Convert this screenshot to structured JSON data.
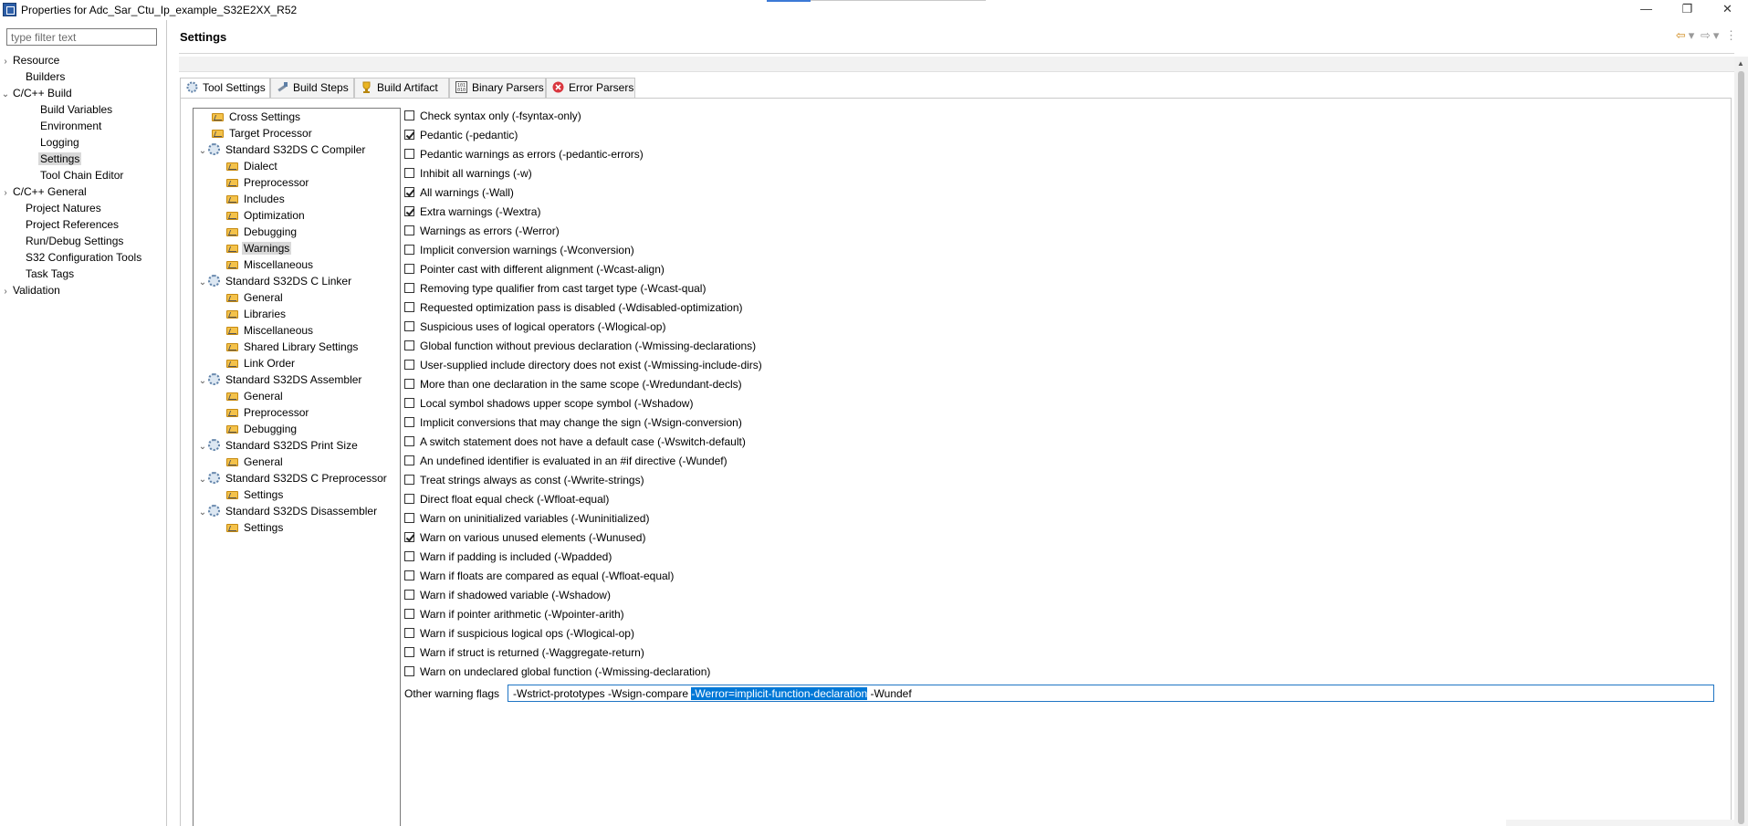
{
  "window": {
    "title": "Properties for Adc_Sar_Ctu_Ip_example_S32E2XX_R52",
    "minimize": "—",
    "restore": "❐",
    "close": "✕"
  },
  "filter": {
    "placeholder": "type filter text"
  },
  "left_tree": [
    {
      "label": "Resource",
      "chevron": "›"
    },
    {
      "label": "Builders",
      "chevron": ""
    },
    {
      "label": "C/C++ Build",
      "chevron": "⌄"
    },
    {
      "label": "Build Variables",
      "chevron": ""
    },
    {
      "label": "Environment",
      "chevron": ""
    },
    {
      "label": "Logging",
      "chevron": ""
    },
    {
      "label": "Settings",
      "chevron": "",
      "selected": true
    },
    {
      "label": "Tool Chain Editor",
      "chevron": ""
    },
    {
      "label": "C/C++ General",
      "chevron": "›"
    },
    {
      "label": "Project Natures",
      "chevron": ""
    },
    {
      "label": "Project References",
      "chevron": ""
    },
    {
      "label": "Run/Debug Settings",
      "chevron": ""
    },
    {
      "label": "S32 Configuration Tools",
      "chevron": ""
    },
    {
      "label": "Task Tags",
      "chevron": ""
    },
    {
      "label": "Validation",
      "chevron": "›"
    }
  ],
  "header": {
    "title": "Settings",
    "back_icon": "⇦",
    "dropdown": "▾",
    "forward_icon": "⇨",
    "menu_icon": "⋮"
  },
  "tabs": [
    {
      "label": "Tool Settings",
      "icon": "tool-settings-icon"
    },
    {
      "label": "Build Steps",
      "icon": "build-steps-icon"
    },
    {
      "label": "Build Artifact",
      "icon": "build-artifact-icon"
    },
    {
      "label": "Binary Parsers",
      "icon": "binary-parsers-icon"
    },
    {
      "label": "Error Parsers",
      "icon": "error-parsers-icon"
    }
  ],
  "tool_tree": [
    {
      "label": "Cross Settings",
      "chevron": ""
    },
    {
      "label": "Target Processor",
      "chevron": ""
    },
    {
      "label": "Standard S32DS C Compiler",
      "chevron": "⌄"
    },
    {
      "label": "Dialect",
      "chevron": ""
    },
    {
      "label": "Preprocessor",
      "chevron": ""
    },
    {
      "label": "Includes",
      "chevron": ""
    },
    {
      "label": "Optimization",
      "chevron": ""
    },
    {
      "label": "Debugging",
      "chevron": ""
    },
    {
      "label": "Warnings",
      "chevron": "",
      "selected": true
    },
    {
      "label": "Miscellaneous",
      "chevron": ""
    },
    {
      "label": "Standard S32DS C Linker",
      "chevron": "⌄"
    },
    {
      "label": "General",
      "chevron": ""
    },
    {
      "label": "Libraries",
      "chevron": ""
    },
    {
      "label": "Miscellaneous",
      "chevron": ""
    },
    {
      "label": "Shared Library Settings",
      "chevron": ""
    },
    {
      "label": "Link Order",
      "chevron": ""
    },
    {
      "label": "Standard S32DS Assembler",
      "chevron": "⌄"
    },
    {
      "label": "General",
      "chevron": ""
    },
    {
      "label": "Preprocessor",
      "chevron": ""
    },
    {
      "label": "Debugging",
      "chevron": ""
    },
    {
      "label": "Standard S32DS Print Size",
      "chevron": "⌄"
    },
    {
      "label": "General",
      "chevron": ""
    },
    {
      "label": "Standard S32DS C Preprocessor",
      "chevron": "⌄"
    },
    {
      "label": "Settings",
      "chevron": ""
    },
    {
      "label": "Standard S32DS Disassembler",
      "chevron": "⌄"
    },
    {
      "label": "Settings",
      "chevron": ""
    }
  ],
  "warnings": [
    {
      "label": "Check syntax only (-fsyntax-only)",
      "checked": false
    },
    {
      "label": "Pedantic (-pedantic)",
      "checked": true
    },
    {
      "label": "Pedantic warnings as errors (-pedantic-errors)",
      "checked": false
    },
    {
      "label": "Inhibit all warnings (-w)",
      "checked": false
    },
    {
      "label": "All warnings (-Wall)",
      "checked": true
    },
    {
      "label": "Extra warnings (-Wextra)",
      "checked": true
    },
    {
      "label": "Warnings as errors (-Werror)",
      "checked": false
    },
    {
      "label": "Implicit conversion warnings (-Wconversion)",
      "checked": false
    },
    {
      "label": "Pointer cast with different alignment (-Wcast-align)",
      "checked": false
    },
    {
      "label": "Removing type qualifier from cast target type (-Wcast-qual)",
      "checked": false
    },
    {
      "label": "Requested optimization pass is disabled (-Wdisabled-optimization)",
      "checked": false
    },
    {
      "label": "Suspicious uses of logical operators (-Wlogical-op)",
      "checked": false
    },
    {
      "label": "Global function without previous declaration (-Wmissing-declarations)",
      "checked": false
    },
    {
      "label": "User-supplied include directory does not exist (-Wmissing-include-dirs)",
      "checked": false
    },
    {
      "label": "More than one declaration in the same scope (-Wredundant-decls)",
      "checked": false
    },
    {
      "label": "Local symbol shadows upper scope symbol (-Wshadow)",
      "checked": false
    },
    {
      "label": "Implicit conversions that may change the sign (-Wsign-conversion)",
      "checked": false
    },
    {
      "label": "A switch statement does not have a default case (-Wswitch-default)",
      "checked": false
    },
    {
      "label": "An undefined identifier is evaluated in an #if directive (-Wundef)",
      "checked": false
    },
    {
      "label": "Treat strings always as const (-Wwrite-strings)",
      "checked": false
    },
    {
      "label": "Direct float equal check (-Wfloat-equal)",
      "checked": false
    },
    {
      "label": "Warn on uninitialized variables (-Wuninitialized)",
      "checked": false
    },
    {
      "label": "Warn on various unused elements (-Wunused)",
      "checked": true
    },
    {
      "label": "Warn if padding is included (-Wpadded)",
      "checked": false
    },
    {
      "label": "Warn if floats are compared as equal (-Wfloat-equal)",
      "checked": false
    },
    {
      "label": "Warn if shadowed variable (-Wshadow)",
      "checked": false
    },
    {
      "label": "Warn if pointer arithmetic (-Wpointer-arith)",
      "checked": false
    },
    {
      "label": "Warn if suspicious logical ops (-Wlogical-op)",
      "checked": false
    },
    {
      "label": "Warn if struct is returned (-Waggregate-return)",
      "checked": false
    },
    {
      "label": "Warn on undeclared global function (-Wmissing-declaration)",
      "checked": false
    }
  ],
  "other_flags": {
    "label": "Other warning flags",
    "value_before": "-Wstrict-prototypes -Wsign-compare ",
    "value_selected": "-Werror=implicit-function-declaration",
    "value_after": " -Wundef"
  }
}
